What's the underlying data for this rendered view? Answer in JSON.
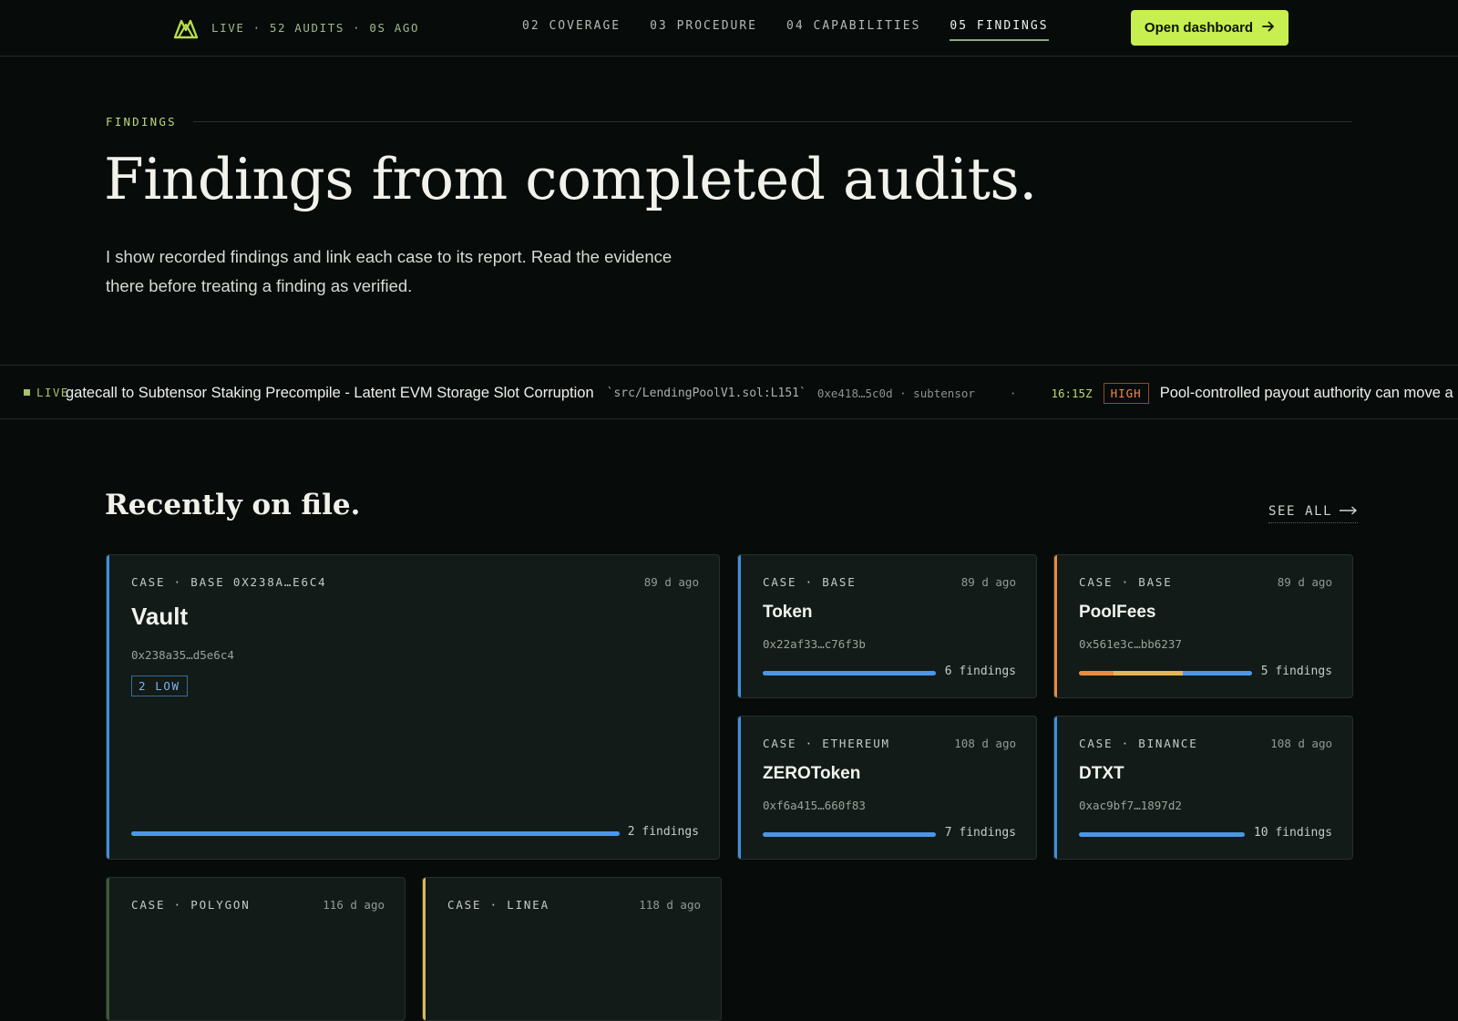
{
  "header": {
    "status": "LIVE · 52 AUDITS · 0S AGO",
    "nav": [
      {
        "label": "02 COVERAGE",
        "active": false
      },
      {
        "label": "03 PROCEDURE",
        "active": false
      },
      {
        "label": "04 CAPABILITIES",
        "active": false
      },
      {
        "label": "05 FINDINGS",
        "active": true
      }
    ],
    "cta_label": "Open dashboard",
    "colors": {
      "accent": "#c7ef4f"
    }
  },
  "findings": {
    "eyebrow": "FINDINGS",
    "title": "Findings from completed audits.",
    "description": "I show recorded findings and link each case to its report. Read the evidence there before treating a finding as verified."
  },
  "ticker": {
    "live_label": "LIVE",
    "item1": {
      "title": "gatecall to Subtensor Staking Precompile - Latent EVM Storage Slot Corruption",
      "path": "`src/LendingPoolV1.sol:L151`",
      "meta": "0xe418…5c0d · subtensor"
    },
    "separator": "·",
    "item2": {
      "time": "16:15Z",
      "severity": "HIGH",
      "title": "Pool-controlled payout authority can move a"
    }
  },
  "recent": {
    "title": "Recently on file.",
    "see_all": "SEE ALL",
    "cards": [
      {
        "kicker": "CASE · BASE 0X238A…E6C4",
        "age": "89 d ago",
        "name": "Vault",
        "address": "0x238a35…d5e6c4",
        "pill": "2 LOW",
        "findings": "2 findings",
        "accent": "#3f8fe0",
        "severity_split": [
          {
            "color": "#4a97ea",
            "share": 1
          }
        ]
      },
      {
        "kicker": "CASE · BASE",
        "age": "89 d ago",
        "name": "Token",
        "address": "0x22af33…c76f3b",
        "findings": "6 findings",
        "accent": "#3f8fe0",
        "severity_split": [
          {
            "color": "#4a97ea",
            "share": 1
          }
        ]
      },
      {
        "kicker": "CASE · BASE",
        "age": "89 d ago",
        "name": "PoolFees",
        "address": "0x561e3c…bb6237",
        "findings": "5 findings",
        "accent": "#e88a3a",
        "severity_split": [
          {
            "color": "#ee8a3c",
            "share": 0.2
          },
          {
            "color": "#e9b452",
            "share": 0.4
          },
          {
            "color": "#4a97ea",
            "share": 0.4
          }
        ]
      },
      {
        "kicker": "CASE · ETHEREUM",
        "age": "108 d ago",
        "name": "ZEROToken",
        "address": "0xf6a415…660f83",
        "findings": "7 findings",
        "accent": "#3f8fe0",
        "severity_split": [
          {
            "color": "#4a97ea",
            "share": 1
          }
        ]
      },
      {
        "kicker": "CASE · BINANCE",
        "age": "108 d ago",
        "name": "DTXT",
        "address": "0xac9bf7…1897d2",
        "findings": "10 findings",
        "accent": "#3f8fe0",
        "severity_split": [
          {
            "color": "#4a97ea",
            "share": 1
          }
        ]
      },
      {
        "kicker": "CASE · POLYGON",
        "age": "116 d ago",
        "accent": "#3c5a3c"
      },
      {
        "kicker": "CASE · LINEA",
        "age": "118 d ago",
        "accent": "#e0b85a"
      }
    ]
  }
}
